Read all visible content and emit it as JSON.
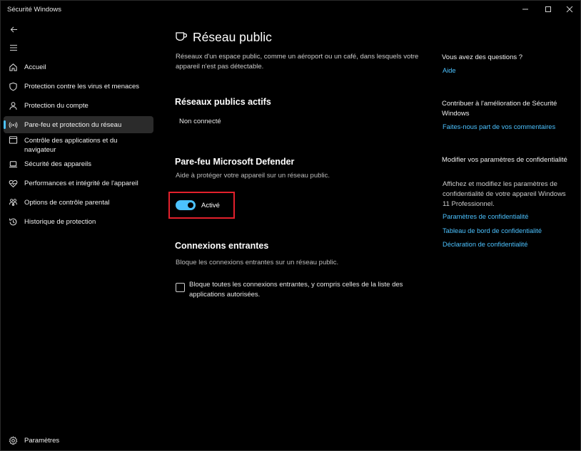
{
  "window": {
    "title": "Sécurité Windows"
  },
  "sidebar": {
    "items": [
      {
        "label": "Accueil",
        "icon": "home-icon"
      },
      {
        "label": "Protection contre les virus et menaces",
        "icon": "shield-icon"
      },
      {
        "label": "Protection du compte",
        "icon": "person-icon"
      },
      {
        "label": "Pare-feu et protection du réseau",
        "icon": "antenna-icon",
        "active": true
      },
      {
        "label": "Contrôle des applications et du navigateur",
        "icon": "browser-window-icon"
      },
      {
        "label": "Sécurité des appareils",
        "icon": "laptop-icon"
      },
      {
        "label": "Performances et intégrité de l'appareil",
        "icon": "heart-pulse-icon"
      },
      {
        "label": "Options de contrôle parental",
        "icon": "family-icon"
      },
      {
        "label": "Historique de protection",
        "icon": "history-icon"
      }
    ],
    "settings_label": "Paramètres"
  },
  "main": {
    "title": "Réseau public",
    "description": "Réseaux d'un espace public, comme un aéroport ou un café, dans lesquels votre appareil n'est pas détectable.",
    "active_networks": {
      "title": "Réseaux publics actifs",
      "status": "Non connecté"
    },
    "firewall": {
      "title": "Pare-feu Microsoft Defender",
      "description": "Aide à protéger votre appareil sur un réseau public.",
      "toggle_label": "Activé",
      "toggle_on": true
    },
    "incoming": {
      "title": "Connexions entrantes",
      "description": "Bloque les connexions entrantes sur un réseau public.",
      "checkbox_label": "Bloque toutes les connexions entrantes, y compris celles de la liste des applications autorisées.",
      "checked": false
    }
  },
  "right_panel": {
    "questions": {
      "heading": "Vous avez des questions ?",
      "link": "Aide"
    },
    "contribute": {
      "heading": "Contribuer à l'amélioration de Sécurité Windows",
      "link": "Faites-nous part de vos commentaires"
    },
    "privacy": {
      "heading": "Modifier vos paramètres de confidentialité",
      "text": "Affichez et modifiez les paramètres de confidentialité de votre appareil Windows 11 Professionnel.",
      "links": [
        "Paramètres de confidentialité",
        "Tableau de bord de confidentialité",
        "Déclaration de confidentialité"
      ]
    }
  },
  "colors": {
    "accent": "#4cc2ff",
    "highlight": "#e3202c",
    "background": "#000000"
  }
}
